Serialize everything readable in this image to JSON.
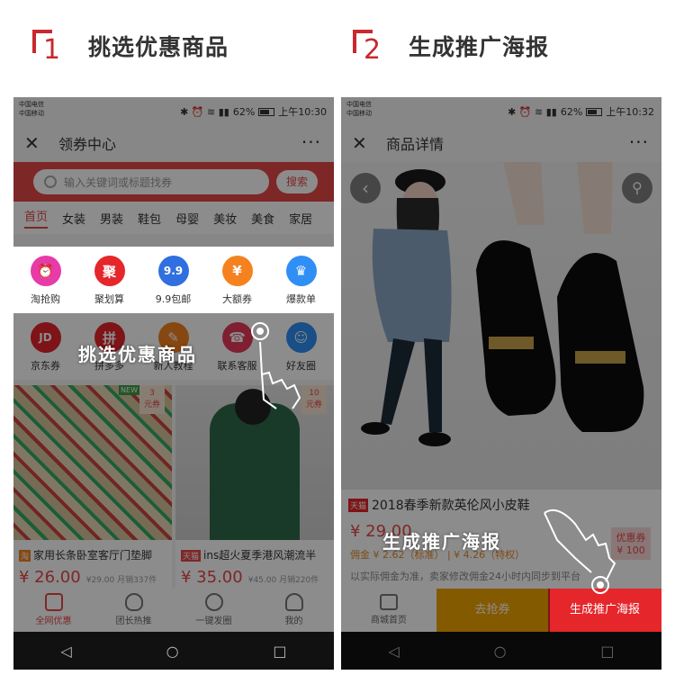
{
  "steps": [
    {
      "num": "1",
      "title": "挑选优惠商品"
    },
    {
      "num": "2",
      "title": "生成推广海报"
    }
  ],
  "status": {
    "carrier1": "中国电信",
    "carrier2": "中国移动",
    "battery": "62%",
    "time1": "上午10:30",
    "time2": "上午10:32"
  },
  "phone1": {
    "nav_title": "领券中心",
    "search_placeholder": "输入关键词或标题找券",
    "search_button": "搜索",
    "categories": [
      "首页",
      "女装",
      "男装",
      "鞋包",
      "母婴",
      "美妆",
      "美食",
      "家居"
    ],
    "row1": [
      {
        "label": "淘抢购",
        "glyph": "⏰",
        "color": "#e83aa8"
      },
      {
        "label": "聚划算",
        "glyph": "聚",
        "color": "#e5262b"
      },
      {
        "label": "9.9包邮",
        "glyph": "9.9",
        "color": "#2f6fe0"
      },
      {
        "label": "大额券",
        "glyph": "¥",
        "color": "#f5821f"
      },
      {
        "label": "爆款单",
        "glyph": "♛",
        "color": "#2f8ff5"
      }
    ],
    "row2": [
      {
        "label": "京东券",
        "glyph": "JD",
        "color": "#e5262b"
      },
      {
        "label": "拼多多",
        "glyph": "拼",
        "color": "#e5262b"
      },
      {
        "label": "新人教程",
        "glyph": "✎",
        "color": "#f5821f"
      },
      {
        "label": "联系客服",
        "glyph": "☎",
        "color": "#e83a5a"
      },
      {
        "label": "好友圈",
        "glyph": "☺",
        "color": "#2f8ff5"
      }
    ],
    "callout": "挑选优惠商品",
    "products": [
      {
        "tag": "淘",
        "name": "家用长条卧室客厅门垫脚",
        "price": "¥ 26.00",
        "extra": "¥29.00 月销337件",
        "badge_top": "3",
        "badge_bottom": "元券",
        "badge_new": "NEW"
      },
      {
        "tag": "天猫",
        "name": "ins超火夏季港风潮流半",
        "price": "¥ 35.00",
        "extra": "¥45.00 月销220件",
        "badge_top": "10",
        "badge_bottom": "元券"
      }
    ],
    "tabs": [
      "全网优惠",
      "团长热推",
      "一键发圈",
      "我的"
    ]
  },
  "phone2": {
    "nav_title": "商品详情",
    "tmall_tag": "天猫",
    "product_name": "2018春季新款英伦风小皮鞋",
    "price": "¥ 29.00",
    "commission": "佣金 ¥ 2.62（标准） | ¥ 4.26（特权）",
    "note": "以实际佣金为准，卖家修改佣金24小时内同步到平台",
    "coupon_label": "优惠券",
    "coupon_value": "¥ 100",
    "callout": "生成推广海报",
    "home_label": "商城首页",
    "grab_label": "去抢券",
    "gen_label": "生成推广海报"
  },
  "colors": {
    "accent": "#c9282d",
    "brand_red": "#e54848",
    "orange": "#f0a400"
  }
}
